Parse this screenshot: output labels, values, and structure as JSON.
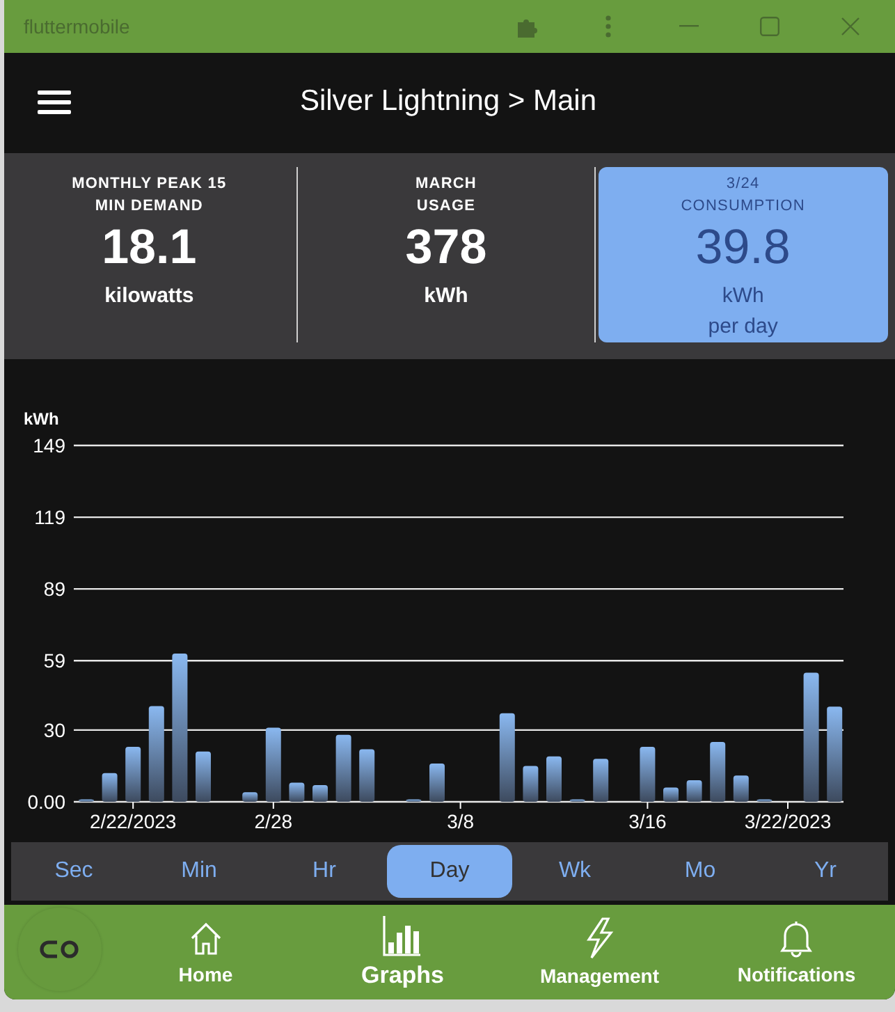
{
  "window": {
    "title": "fluttermobile"
  },
  "app_bar": {
    "title": "Silver Lightning > Main"
  },
  "stats": [
    {
      "label_lines": [
        "MONTHLY PEAK 15",
        "MIN DEMAND"
      ],
      "value": "18.1",
      "unit_lines": [
        "kilowatts"
      ],
      "selected": false
    },
    {
      "label_lines": [
        "MARCH",
        "USAGE"
      ],
      "value": "378",
      "unit_lines": [
        "kWh"
      ],
      "selected": false
    },
    {
      "label_lines": [
        "3/24",
        "CONSUMPTION"
      ],
      "value": "39.8",
      "unit_lines": [
        "kWh",
        "per day"
      ],
      "selected": true
    }
  ],
  "chart": {
    "chart_data": {
      "type": "bar",
      "ylabel": "kWh",
      "categories": [
        null,
        null,
        "2/22/2023",
        null,
        null,
        null,
        null,
        null,
        "2/28",
        null,
        null,
        null,
        null,
        null,
        null,
        null,
        "3/8",
        null,
        null,
        null,
        null,
        null,
        null,
        null,
        "3/16",
        null,
        null,
        null,
        null,
        null,
        "3/22/2023",
        null,
        null
      ],
      "grid": true,
      "values": [
        1,
        12,
        23,
        40,
        62,
        21,
        0,
        4,
        31,
        8,
        7,
        28,
        22,
        0,
        1,
        16,
        0,
        0,
        37,
        15,
        19,
        1,
        18,
        0,
        23,
        6,
        9,
        25,
        11,
        1,
        0,
        54,
        39.8
      ],
      "ylim": [
        0,
        149
      ],
      "yticks": [
        {
          "value": 0,
          "label": "0.00"
        },
        30,
        59,
        89,
        119,
        149
      ]
    }
  },
  "periods": [
    {
      "label": "Sec",
      "selected": false
    },
    {
      "label": "Min",
      "selected": false
    },
    {
      "label": "Hr",
      "selected": false
    },
    {
      "label": "Day",
      "selected": true
    },
    {
      "label": "Wk",
      "selected": false
    },
    {
      "label": "Mo",
      "selected": false
    },
    {
      "label": "Yr",
      "selected": false
    }
  ],
  "nav": [
    {
      "kind": "home",
      "label": "Home",
      "selected": false
    },
    {
      "kind": "graphs",
      "label": "Graphs",
      "selected": true
    },
    {
      "kind": "management",
      "label": "Management",
      "selected": false
    },
    {
      "kind": "notifications",
      "label": "Notifications",
      "selected": false
    }
  ]
}
